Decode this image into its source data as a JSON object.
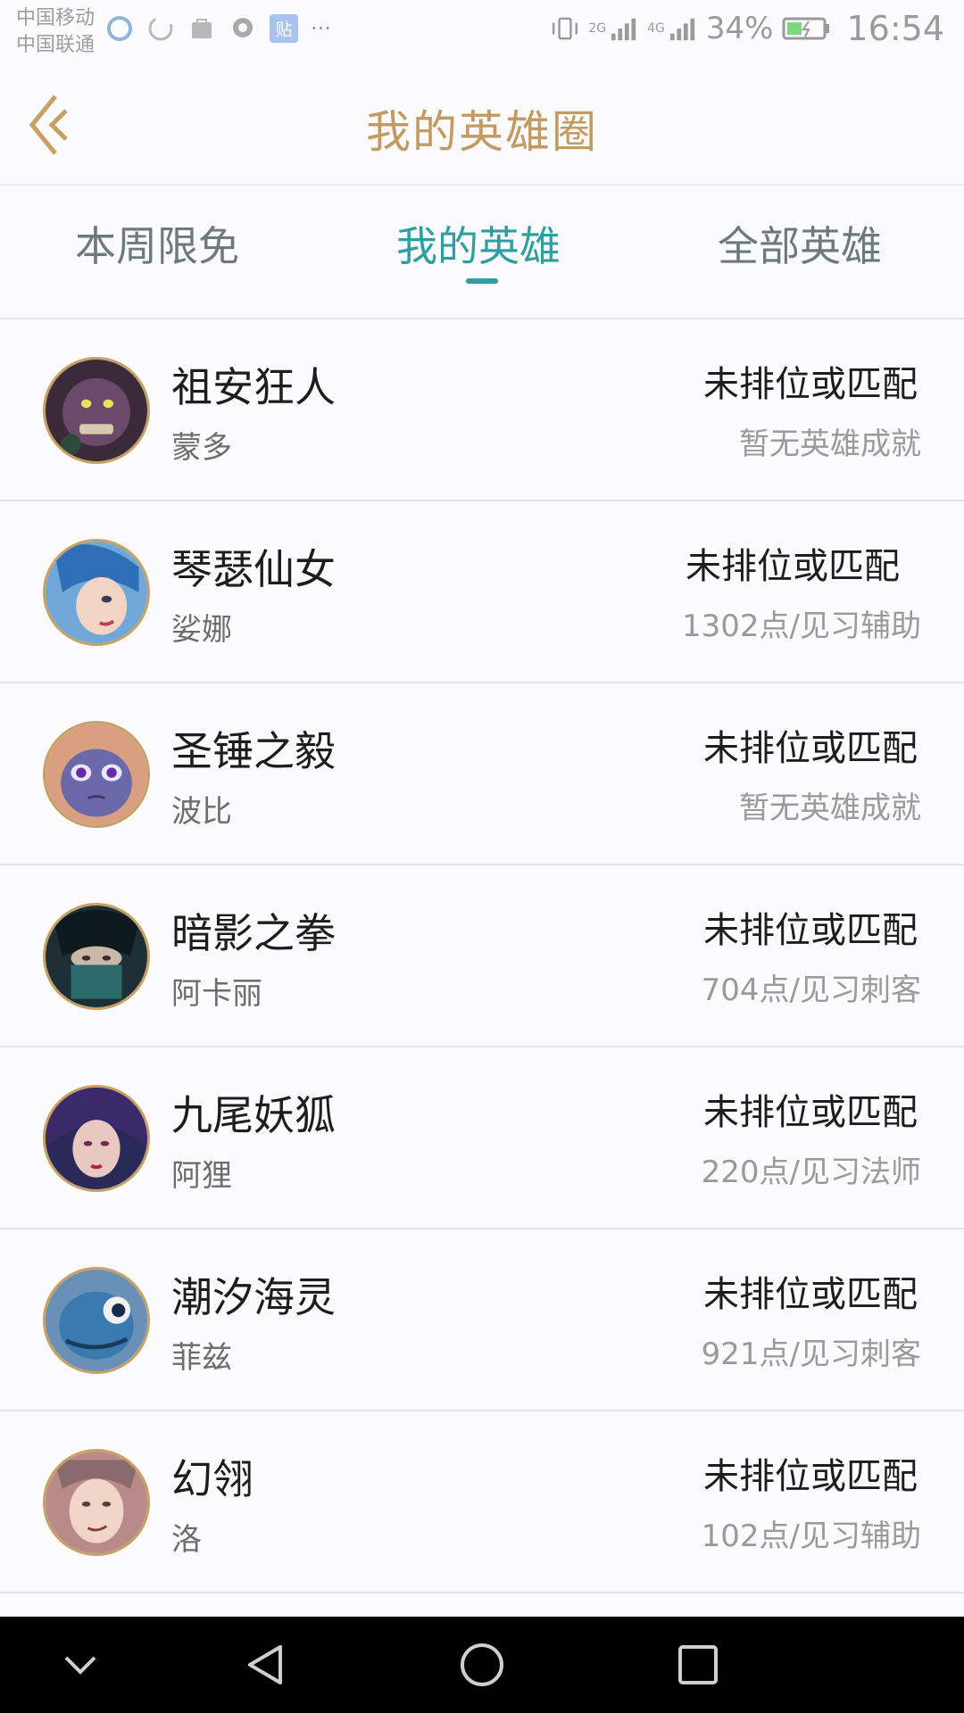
{
  "status_bar": {
    "carrier_1": "中国移动",
    "carrier_2": "中国联通",
    "network_1": "2G",
    "network_2": "4G",
    "battery_percent": "34%",
    "time": "16:54",
    "more": "···"
  },
  "header": {
    "title": "我的英雄圈"
  },
  "tabs": [
    {
      "label": "本周限免",
      "active": false
    },
    {
      "label": "我的英雄",
      "active": true
    },
    {
      "label": "全部英雄",
      "active": false
    }
  ],
  "heroes": [
    {
      "title": "祖安狂人",
      "name": "蒙多",
      "rank": "未排位或匹配",
      "achievement": "暂无英雄成就"
    },
    {
      "title": "琴瑟仙女",
      "name": "娑娜",
      "rank": "未排位或匹配",
      "achievement": "1302点/见习辅助"
    },
    {
      "title": "圣锤之毅",
      "name": "波比",
      "rank": "未排位或匹配",
      "achievement": "暂无英雄成就"
    },
    {
      "title": "暗影之拳",
      "name": "阿卡丽",
      "rank": "未排位或匹配",
      "achievement": "704点/见习刺客"
    },
    {
      "title": "九尾妖狐",
      "name": "阿狸",
      "rank": "未排位或匹配",
      "achievement": "220点/见习法师"
    },
    {
      "title": "潮汐海灵",
      "name": "菲兹",
      "rank": "未排位或匹配",
      "achievement": "921点/见习刺客"
    },
    {
      "title": "幻翎",
      "name": "洛",
      "rank": "未排位或匹配",
      "achievement": "102点/见习辅助"
    }
  ],
  "colors": {
    "accent": "#2e9ea0",
    "title_gold": "#c29a62",
    "avatar_border": "#c8a064"
  }
}
